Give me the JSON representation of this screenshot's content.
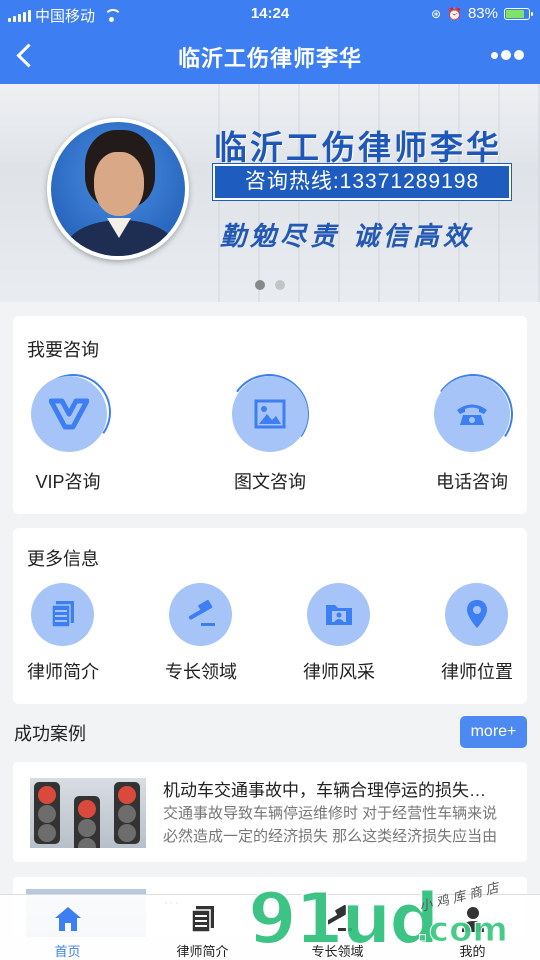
{
  "status_bar": {
    "carrier": "中国移动",
    "time": "14:24",
    "battery_percent": "83%",
    "battery_level": 0.83,
    "icons": [
      "signal-icon",
      "wifi-icon",
      "rotation-lock-icon",
      "alarm-icon",
      "battery-icon"
    ]
  },
  "nav": {
    "title": "临沂工伤律师李华",
    "icons": [
      "back-icon",
      "more-icon"
    ]
  },
  "banner": {
    "title": "临沂工伤律师李华",
    "hotline": "咨询热线:13371289198",
    "slogan": "勤勉尽责  诚信高效",
    "slide_count": 2,
    "active_slide": 1,
    "colors": {
      "title": "#1e57b8",
      "hotline_bg": "#1f5cbf"
    }
  },
  "consult": {
    "title": "我要咨询",
    "items": [
      {
        "label": "VIP咨询",
        "icon": "vip-icon"
      },
      {
        "label": "图文咨询",
        "icon": "image-icon"
      },
      {
        "label": "电话咨询",
        "icon": "telephone-icon"
      }
    ]
  },
  "more_info": {
    "title": "更多信息",
    "items": [
      {
        "label": "律师简介",
        "icon": "document-icon"
      },
      {
        "label": "专长领域",
        "icon": "gavel-icon"
      },
      {
        "label": "律师风采",
        "icon": "folder-person-icon"
      },
      {
        "label": "律师位置",
        "icon": "location-pin-icon"
      }
    ]
  },
  "cases": {
    "title": "成功案例",
    "more_label": "more+",
    "items": [
      {
        "title": "机动车交通事故中，车辆合理停运的损失…",
        "desc": "交通事故导致车辆停运维修时 对于经营性车辆来说 必然造成一定的经济损失 那么这类经济损失应当由"
      },
      {
        "title": "…"
      }
    ]
  },
  "tabbar": {
    "tabs": [
      {
        "label": "首页",
        "icon": "home-icon",
        "active": true
      },
      {
        "label": "律师简介",
        "icon": "document-icon",
        "active": false
      },
      {
        "label": "专长领域",
        "icon": "gavel-icon",
        "active": false
      },
      {
        "label": "我的",
        "icon": "user-icon",
        "active": false
      }
    ]
  },
  "watermark": {
    "main": "91ud",
    "suffix": ".com",
    "small": "小鸡库商店"
  },
  "colors": {
    "primary": "#3d7ff2",
    "icon_circle": "#a7c4f8",
    "icon_glyph": "#3d7ff2",
    "more_button": "#4c89f0"
  }
}
